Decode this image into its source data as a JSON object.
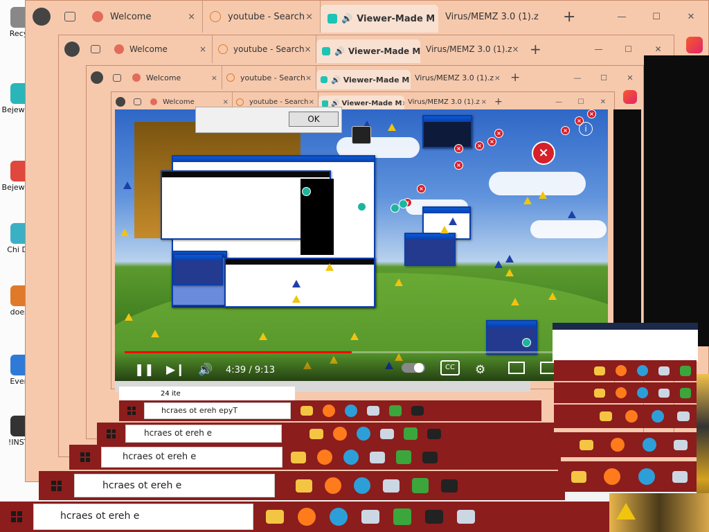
{
  "desktop": {
    "icons": [
      {
        "label": "Recyc"
      },
      {
        "label": "Bejew Del"
      },
      {
        "label": "Bejew Del"
      },
      {
        "label": "Chi Del"
      },
      {
        "label": "doesr"
      },
      {
        "label": "Every"
      },
      {
        "label": "!INSTA"
      }
    ]
  },
  "browser": {
    "tabs": [
      {
        "label": "Welcome",
        "favicon": "welcome-icon"
      },
      {
        "label": "youtube - Search",
        "favicon": "search-icon"
      },
      {
        "label": "Viewer-Made M",
        "favicon": "audio-icon"
      },
      {
        "label": "Virus/MEMZ 3.0 (1).z",
        "favicon": "file-icon"
      }
    ],
    "new_tab": "+",
    "close": "×",
    "minimize": "—",
    "maximize": "☐",
    "window_close": "✕"
  },
  "video": {
    "time_current": "4:39",
    "time_total": "9:13",
    "time_display": "4:39 / 9:13",
    "progress_fraction": 0.48,
    "cc_label": "CC",
    "ok_label": "OK",
    "info_label": "i"
  },
  "taskbar": {
    "search_text": "hcraes ot ereh e",
    "search_text_alt": "hcraes ot ereh epyT",
    "items_label": "24 ite"
  },
  "colors": {
    "tab_bg": "#f6c9ad",
    "progress": "#ff0000",
    "taskbar_stripe": "#8b1d1d"
  }
}
